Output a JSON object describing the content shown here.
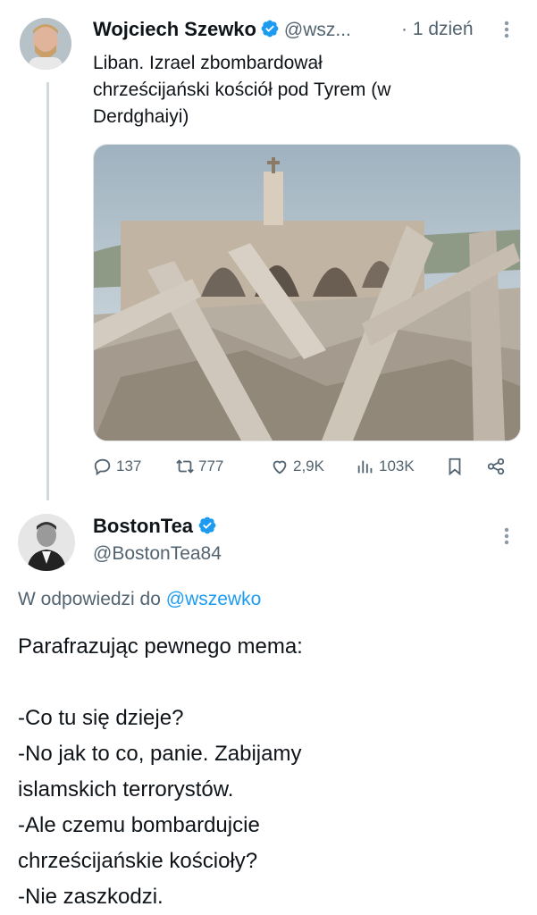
{
  "tweet": {
    "author_name": "Wojciech Szewko",
    "author_handle": "@wsz...",
    "time": "· 1 dzień",
    "text_lines": [
      "Liban. Izrael zbombardował",
      "chrześcijański kościół pod Tyrem (w",
      "Derdghaiyi)"
    ],
    "stats": {
      "replies": "137",
      "retweets": "777",
      "likes": "2,9K",
      "views": "103K"
    }
  },
  "reply": {
    "author_name": "BostonTea",
    "author_handle": "@BostonTea84",
    "replying_to_prefix": "W odpowiedzi do",
    "replying_to_handle": "@wszewko",
    "body_lines": [
      "Parafrazując pewnego mema:",
      "-Co tu się dzieje?",
      "-No jak to co, panie. Zabijamy",
      "islamskich terrorystów.",
      "-Ale czemu bombardujcie",
      "chrześcijańskie kościoły?",
      "-Nie zaszkodzi."
    ]
  },
  "colors": {
    "verified": "#1d9bf0",
    "muted": "#536471",
    "link": "#1d9bf0"
  },
  "icons": [
    "reply-icon",
    "retweet-icon",
    "like-icon",
    "views-icon",
    "bookmark-icon",
    "share-icon",
    "more-icon",
    "verified-badge-icon"
  ]
}
